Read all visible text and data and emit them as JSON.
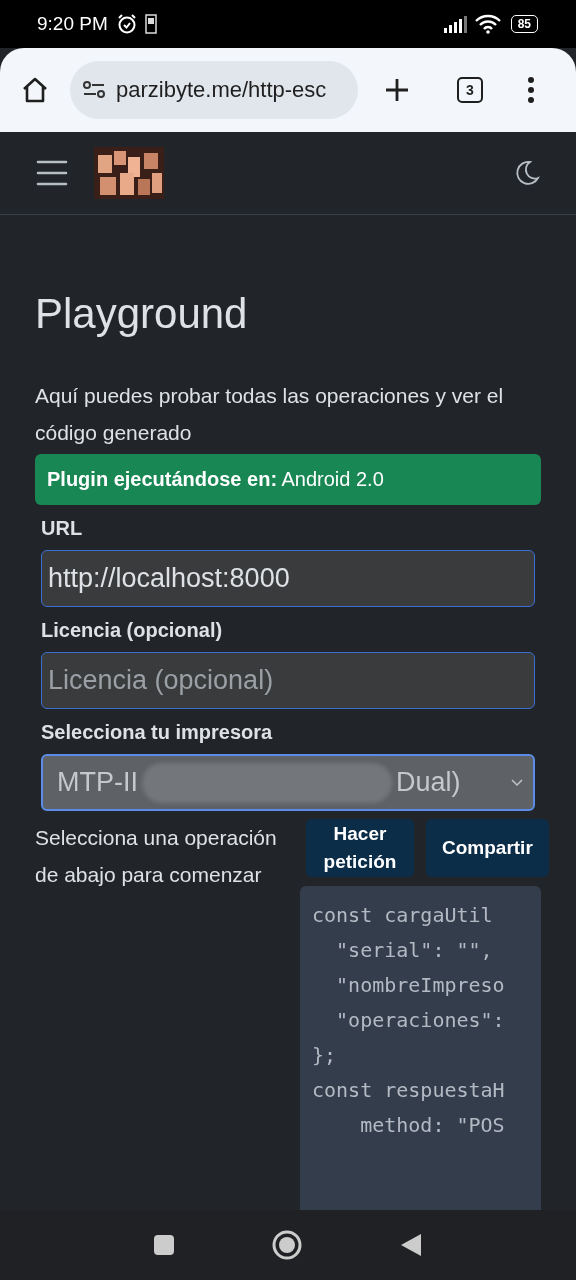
{
  "status_bar": {
    "time": "9:20 PM",
    "battery": "85"
  },
  "browser": {
    "url": "parzibyte.me/http-esc",
    "tab_count": "3"
  },
  "page": {
    "title": "Playground",
    "intro": "Aquí puedes probar todas las operaciones y ver el código generado",
    "alert": "**Plugin ejecutándose en:** Android 2.0",
    "fields": [
      {
        "kind": "input",
        "label": "URL",
        "value": "http://localhost:8000"
      },
      {
        "kind": "input",
        "label": "Licencia (opcional)",
        "placeholder": "Licencia (opcional)"
      },
      {
        "kind": "select",
        "label": "Selecciona tu impresora",
        "value_start": "MTP-II",
        "value_end": "Dual)"
      }
    ],
    "hint": "Selecciona una operación de abajo para comenzar",
    "buttons": [
      "Hacer petición",
      "Compartir"
    ],
    "code_lines": [
      "const cargaUtil",
      "  \"serial\": \"\",",
      "  \"nombreImpreso",
      "  \"operaciones\":",
      "};",
      "const respuestaH",
      "    method: \"POS"
    ]
  }
}
